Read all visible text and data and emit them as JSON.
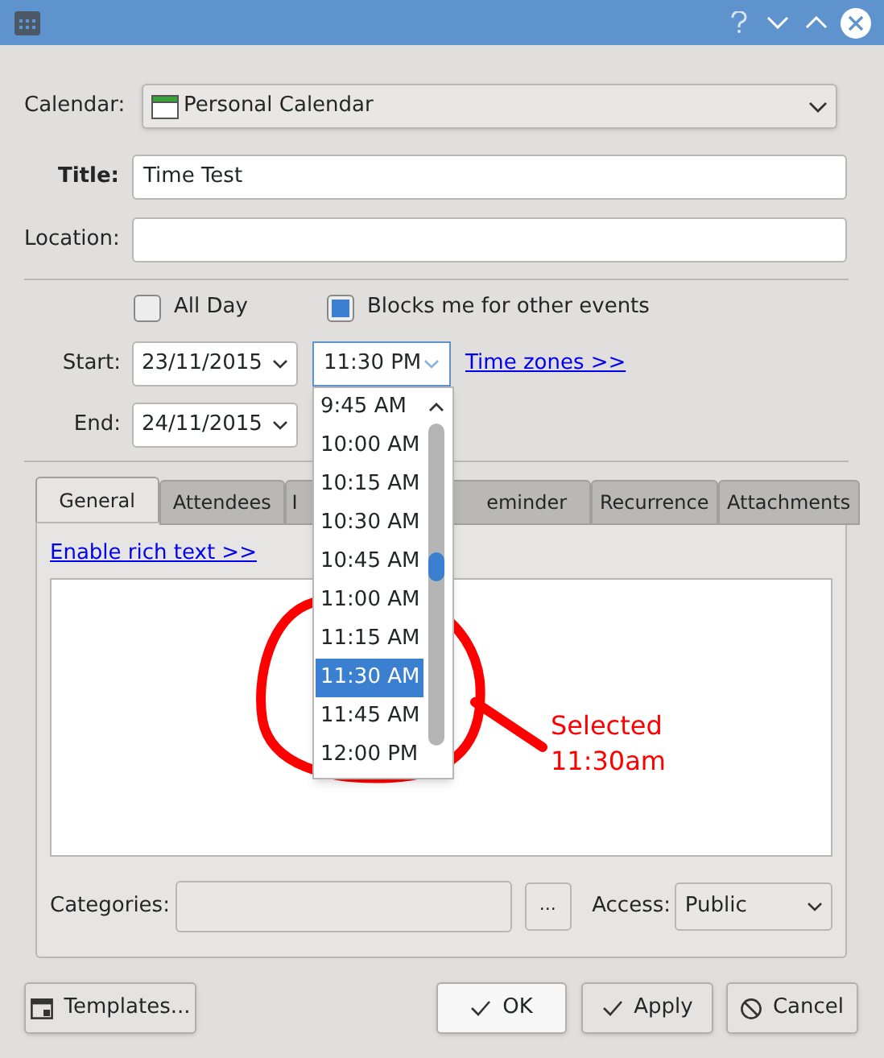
{
  "form": {
    "calendar": {
      "label": "Calendar:",
      "value": "Personal Calendar"
    },
    "title": {
      "label": "Title:",
      "value": "Time Test"
    },
    "location": {
      "label": "Location:"
    },
    "all_day": {
      "label": "All Day",
      "checked": false
    },
    "blocks": {
      "label": "Blocks me for other events",
      "checked": true
    },
    "start": {
      "label": "Start:",
      "date": "23/11/2015",
      "time": "11:30 PM",
      "link": "Time zones >>"
    },
    "end": {
      "label": "End:",
      "date": "24/11/2015"
    }
  },
  "tabs": [
    {
      "label": "General",
      "selected": true
    },
    {
      "label": "Attendees",
      "selected": false
    },
    {
      "label": "I",
      "selected": false
    },
    {
      "label": "eminder",
      "selected": false
    },
    {
      "label": "Recurrence",
      "selected": false
    },
    {
      "label": "Attachments",
      "selected": false
    }
  ],
  "panel": {
    "link": "Enable rich text >>",
    "categories_label": "Categories:",
    "more_button": "...",
    "access_label": "Access:",
    "access_value": "Public"
  },
  "buttons": [
    {
      "label": "Templates...",
      "kind": "templates"
    },
    {
      "label": "OK",
      "kind": "ok"
    },
    {
      "label": "Apply",
      "kind": "apply"
    },
    {
      "label": "Cancel",
      "kind": "cancel"
    }
  ],
  "time_list": [
    {
      "label": "9:45 AM",
      "selected": false
    },
    {
      "label": "10:00 AM",
      "selected": false
    },
    {
      "label": "10:15 AM",
      "selected": false
    },
    {
      "label": "10:30 AM",
      "selected": false
    },
    {
      "label": "10:45 AM",
      "selected": false
    },
    {
      "label": "11:00 AM",
      "selected": false
    },
    {
      "label": "11:15 AM",
      "selected": false
    },
    {
      "label": "11:30 AM",
      "selected": true
    },
    {
      "label": "11:45 AM",
      "selected": false
    },
    {
      "label": "12:00 PM",
      "selected": false
    }
  ],
  "annotation": [
    "Selected",
    "11:30am"
  ]
}
